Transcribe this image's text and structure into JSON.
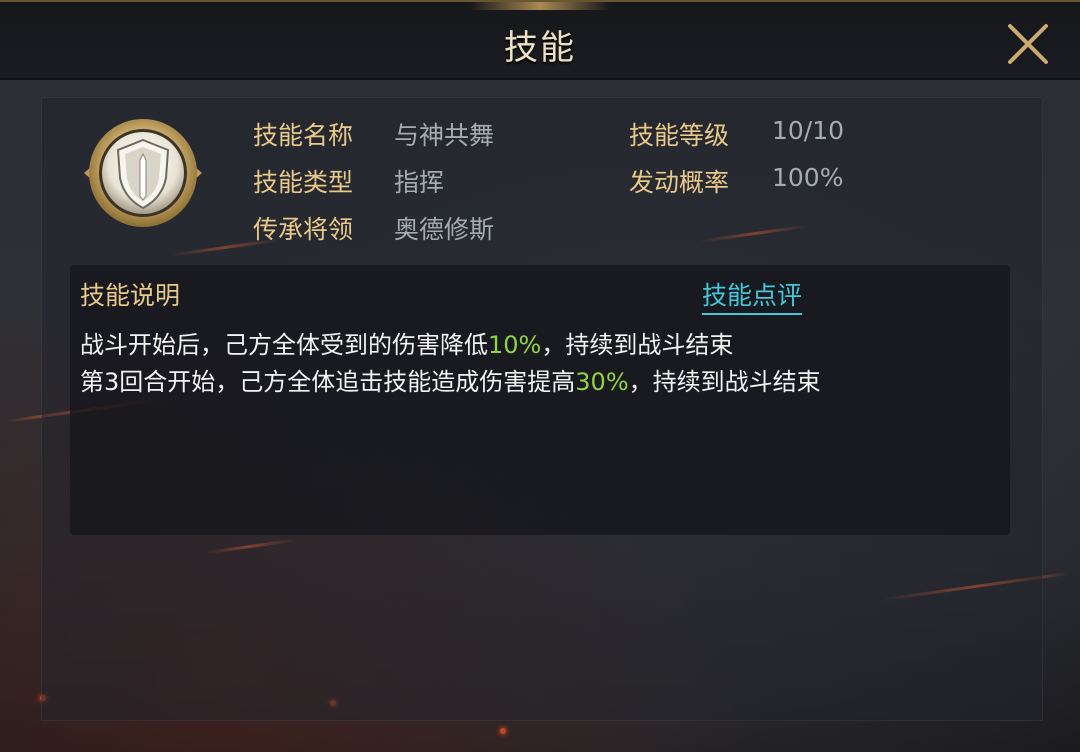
{
  "header": {
    "title": "技能",
    "close_icon": "close-icon"
  },
  "skill": {
    "icon": "shield-icon",
    "name_label": "技能名称",
    "name_value": "与神共舞",
    "type_label": "技能类型",
    "type_value": "指挥",
    "heir_label": "传承将领",
    "heir_value": "奥德修斯",
    "level_label": "技能等级",
    "level_value": "10/10",
    "rate_label": "发动概率",
    "rate_value": "100%"
  },
  "description": {
    "title": "技能说明",
    "review_link": "技能点评",
    "line1": {
      "pre": "战斗开始后，己方全体受到的伤害降低",
      "highlight": "10%",
      "post": "，持续到战斗结束"
    },
    "line2": {
      "pre": "第3回合开始，己方全体追击技能造成伤害提高",
      "highlight": "30%",
      "post": "，持续到战斗结束"
    }
  },
  "colors": {
    "label": "#e9c98a",
    "value": "#a6aab2",
    "highlight": "#8fd43f",
    "link": "#45c7d9",
    "title": "#efe2c4"
  }
}
